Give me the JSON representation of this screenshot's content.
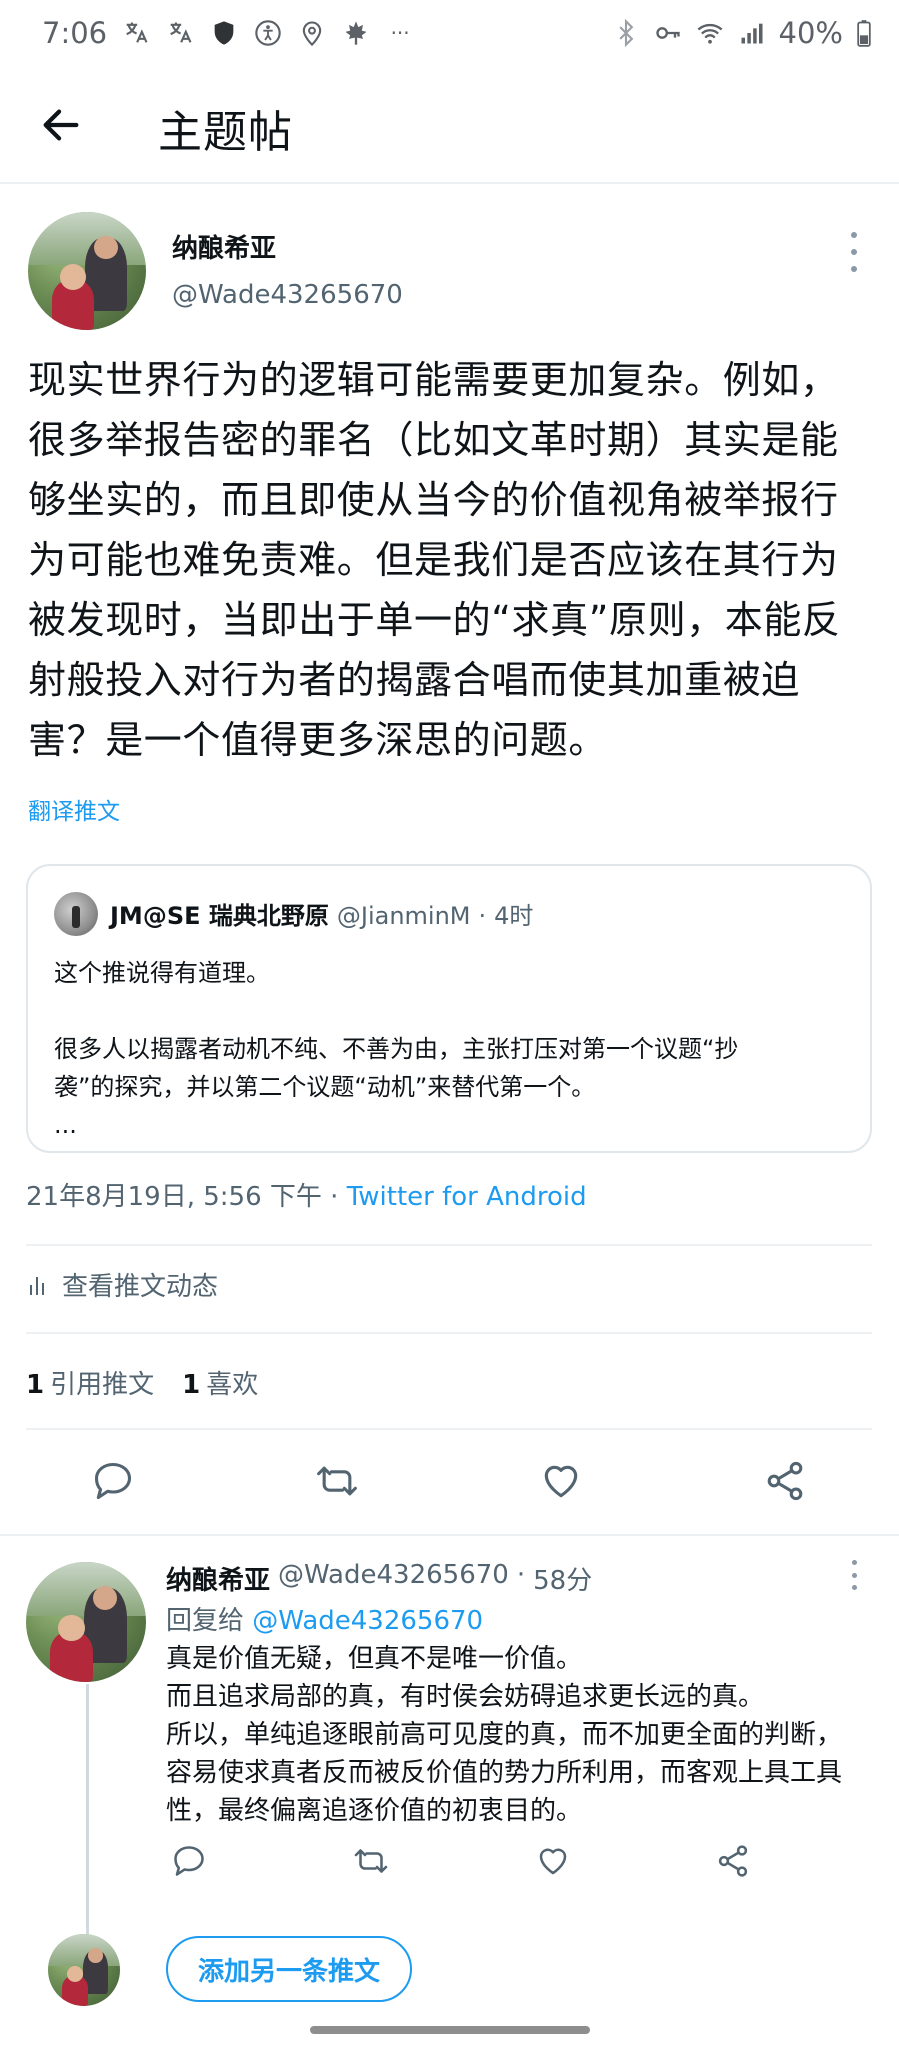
{
  "status_bar": {
    "time": "7:06",
    "left_icons": [
      "translate-icon",
      "translate-icon",
      "shield-icon",
      "accessibility-icon",
      "location-icon",
      "leaf-icon",
      "more-dots-icon"
    ],
    "right_icons": [
      "bluetooth-icon",
      "key-icon",
      "wifi-icon",
      "signal-icon",
      "battery-icon"
    ],
    "battery": "40%"
  },
  "header": {
    "title": "主题帖",
    "back_label": "←"
  },
  "main_tweet": {
    "author_name": "纳酿希亚",
    "author_handle": "@Wade43265670",
    "text": "现实世界行为的逻辑可能需要更加复杂。例如，\n很多举报告密的罪名（比如文革时期）其实是能\n够坐实的，而且即使从当今的价值视角被举报行\n为可能也难免责难。但是我们是否应该在其行为\n被发现时，当即出于单一的“求真”原则，本能反\n射般投入对行为者的揭露合唱而使其加重被迫\n害？是一个值得更多深思的问题。",
    "translate_label": "翻译推文",
    "quoted": {
      "author_name": "JM@SE 瑞典北野原",
      "author_handle": "@JianminM",
      "dot": "·",
      "time": "4时",
      "lines": [
        "这个推说得有道理。",
        "",
        "很多人以揭露者动机不纯、不善为由，主张打压对第一个议题“抄",
        "袭”的探究，并以第二个议题“动机”来替代第一个。",
        "..."
      ]
    },
    "timestamp": "21年8月19日, 5:56 下午 ·",
    "source_app": "Twitter for Android",
    "activity_label": "查看推文动态",
    "stats": [
      {
        "count": "1",
        "label": "引用推文"
      },
      {
        "count": "1",
        "label": "喜欢"
      }
    ]
  },
  "reply": {
    "author_name": "纳酿希亚",
    "author_handle": "@Wade43265670",
    "dot": "·",
    "time": "58分",
    "reply_to_prefix": "回复给",
    "reply_to_handle": "@Wade43265670",
    "lines": [
      "真是价值无疑，但真不是唯一价值。",
      "而且追求局部的真，有时侯会妨碍追求更长远的真。",
      "所以，单纯追逐眼前高可见度的真，而不加更全面的判断，",
      "容易使求真者反而被反价值的势力所利用，而客观上具工具",
      "性，最终偏离追逐价值的初衷目的。"
    ]
  },
  "compose": {
    "add_label": "添加另一条推文"
  },
  "colors": {
    "accent": "#1d9bf0",
    "secondary_text": "#536471",
    "text": "#0f1419",
    "divider": "#eef1f3"
  }
}
